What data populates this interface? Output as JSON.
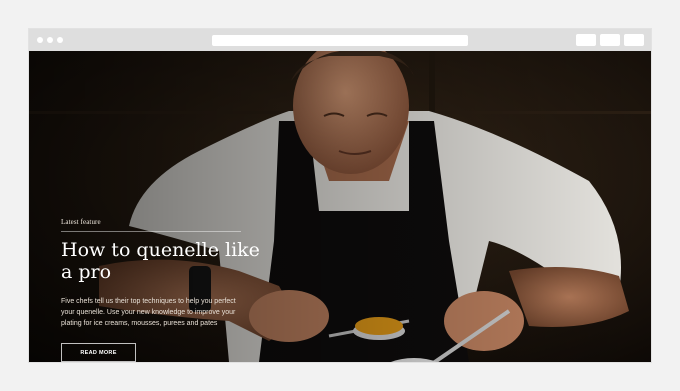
{
  "hero": {
    "eyebrow": "Latest feature",
    "headline": "How to quenelle like a pro",
    "description": "Five chefs tell us their top techniques to help you perfect your quenelle. Use your new knowledge to improve your plating for ice creams, mousses, purees and pates",
    "cta_label": "READ MORE"
  },
  "colors": {
    "page_background": "#f2f2f2",
    "chrome_bar": "#dedede",
    "hero_dark": "#151008"
  },
  "icons": [
    "window-dot-icon",
    "window-dot-icon",
    "window-dot-icon"
  ]
}
